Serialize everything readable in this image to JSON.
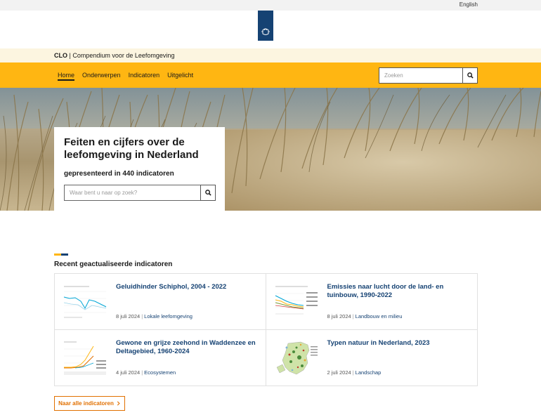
{
  "topbar": {
    "language_link": "English"
  },
  "site": {
    "abbr": "CLO",
    "name": "Compendium voor de Leefomgeving"
  },
  "nav": {
    "items": [
      "Home",
      "Onderwerpen",
      "Indicatoren",
      "Uitgelicht"
    ],
    "search_placeholder": "Zoeken"
  },
  "hero": {
    "title": "Feiten en cijfers over de leefomgeving in Nederland",
    "subtitle": "gepresenteerd in 440 indicatoren",
    "search_placeholder": "Waar bent u naar op zoek?"
  },
  "recent": {
    "title": "Recent geactualiseerde indicatoren",
    "cards": [
      {
        "title": "Geluidhinder Schiphol, 2004 - 2022",
        "date": "8 juli 2024",
        "tag": "Lokale leefomgeving"
      },
      {
        "title": "Emissies naar lucht door de land- en tuinbouw, 1990-2022",
        "date": "8 juli 2024",
        "tag": "Landbouw en milieu"
      },
      {
        "title": "Gewone en grijze zeehond in Waddenzee en Deltagebied, 1960-2024",
        "date": "4 juli 2024",
        "tag": "Ecosystemen"
      },
      {
        "title": "Typen natuur in Nederland, 2023",
        "date": "2 juli 2024",
        "tag": "Landschap"
      }
    ],
    "all_button": "Naar alle indicatoren",
    "separator": "|"
  },
  "colors": {
    "accent": "#ffb612",
    "brand": "#154273",
    "link_orange": "#e17000"
  },
  "icons": {
    "search": "search-icon",
    "crest": "crest-icon",
    "chevron": "chevron-right-icon"
  }
}
